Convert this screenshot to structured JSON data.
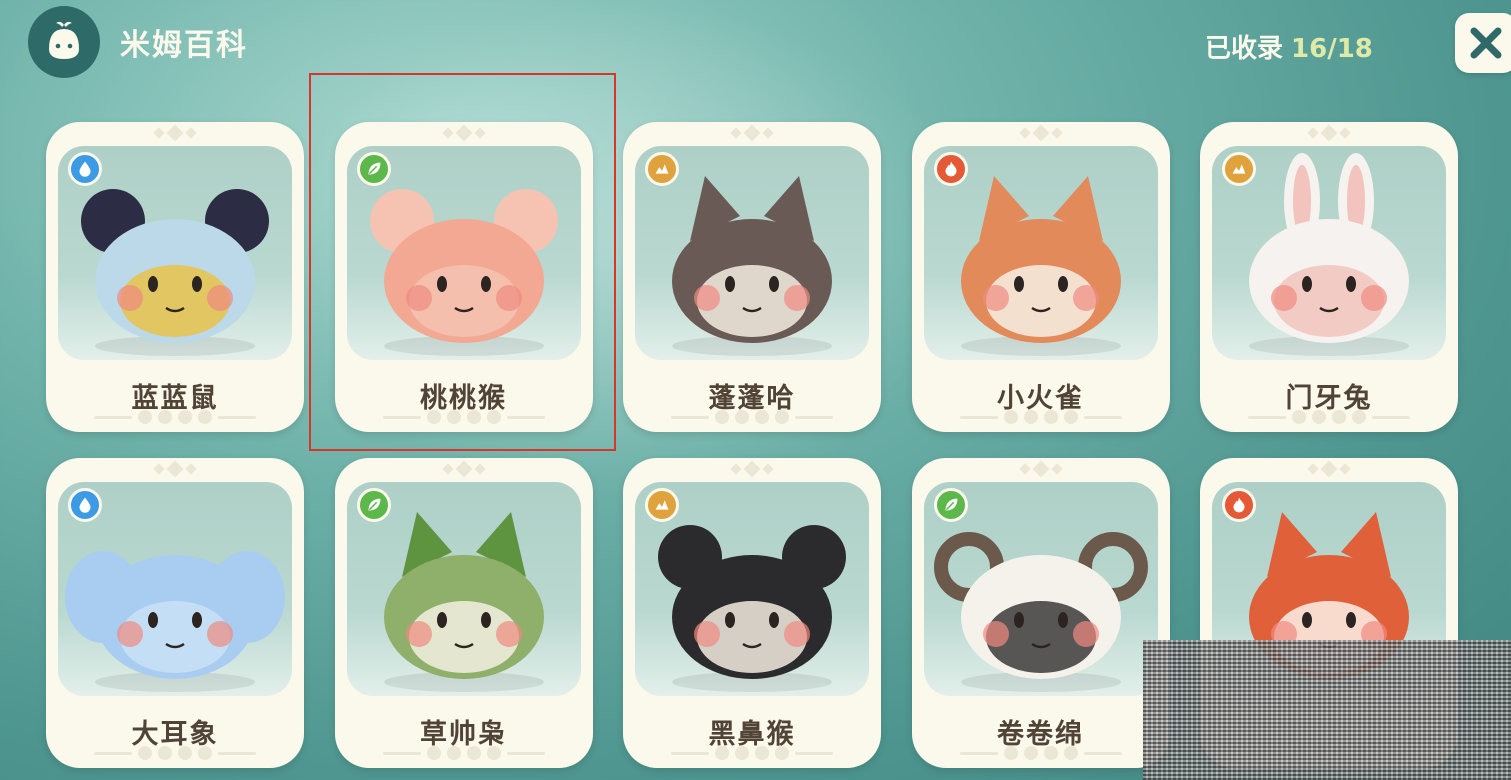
{
  "header": {
    "title": "米姆百科",
    "collected_label": "已收录",
    "collected_count": "16/18",
    "logo_icon": "slime-logo-icon",
    "close_icon": "close-icon"
  },
  "colors": {
    "water": "#3d9be6",
    "grass": "#5cb84a",
    "earth": "#e0a23c",
    "fire": "#e55a36",
    "selection": "#d8352b"
  },
  "cards": [
    {
      "name": "蓝蓝鼠",
      "type": "water",
      "type_icon": "water-drop-icon",
      "creature": "blue-mouse"
    },
    {
      "name": "桃桃猴",
      "type": "grass",
      "type_icon": "leaf-icon",
      "creature": "peach-monkey",
      "selected": true
    },
    {
      "name": "蓬蓬哈",
      "type": "earth",
      "type_icon": "rock-icon",
      "creature": "fluffy-dog"
    },
    {
      "name": "小火雀",
      "type": "fire",
      "type_icon": "flame-icon",
      "creature": "fire-sparrow"
    },
    {
      "name": "门牙兔",
      "type": "earth",
      "type_icon": "rock-icon",
      "creature": "bucktooth-rabbit"
    },
    {
      "name": "大耳象",
      "type": "water",
      "type_icon": "water-drop-icon",
      "creature": "big-ear-elephant"
    },
    {
      "name": "草帅枭",
      "type": "grass",
      "type_icon": "leaf-icon",
      "creature": "grass-owl"
    },
    {
      "name": "黑鼻猴",
      "type": "earth",
      "type_icon": "rock-icon",
      "creature": "black-nose-monkey"
    },
    {
      "name": "卷卷绵",
      "type": "grass",
      "type_icon": "leaf-icon",
      "creature": "curly-sheep"
    },
    {
      "name": "",
      "type": "fire",
      "type_icon": "flame-icon",
      "creature": "fire-fox"
    }
  ]
}
